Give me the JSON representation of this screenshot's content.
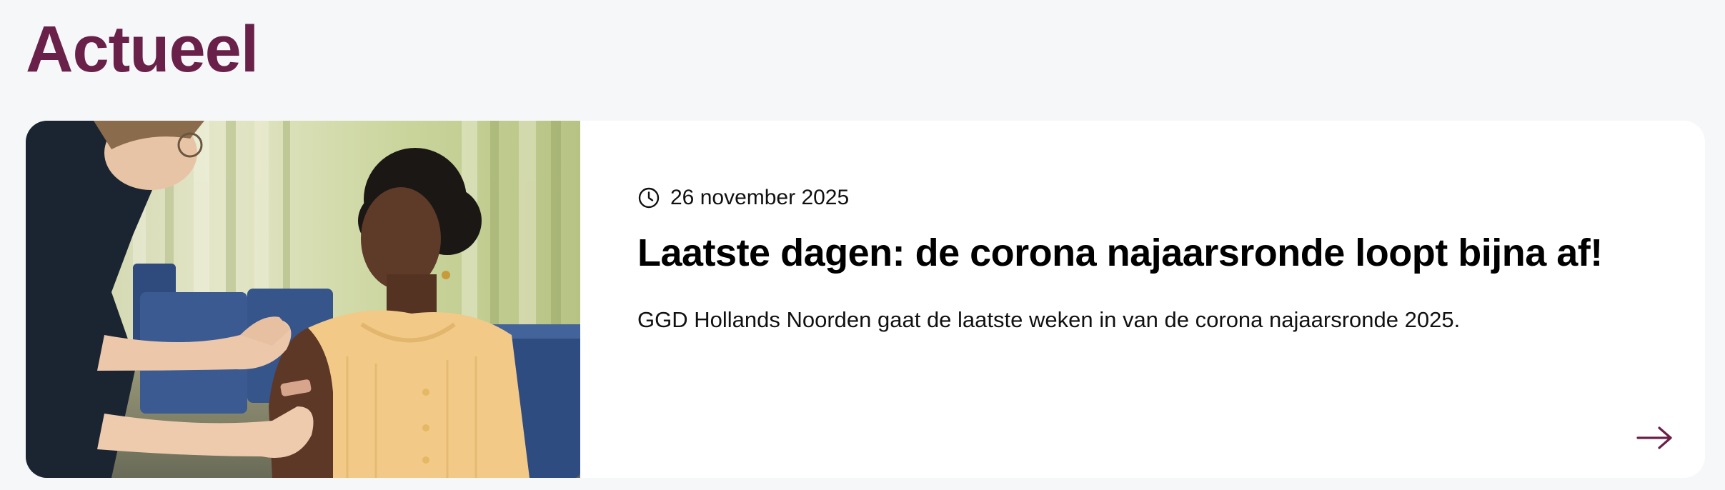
{
  "section": {
    "title": "Actueel"
  },
  "news_item": {
    "date": "26 november 2025",
    "title": "Laatste dagen: de corona najaarsronde loopt bijna af!",
    "summary": "GGD Hollands Noorden gaat de laatste weken in van de corona najaarsronde 2025.",
    "image_subject": "photo of a nurse vaccinating a woman in a yellow cardigan",
    "icons": {
      "date": "clock-icon",
      "link": "arrow-right-icon"
    }
  },
  "colors": {
    "page_background": "#f6f7f9",
    "brand": "#6a2149",
    "card_background": "#ffffff",
    "text": "#111111"
  }
}
